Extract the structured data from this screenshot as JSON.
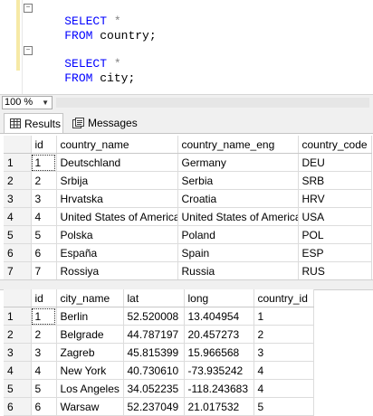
{
  "editor": {
    "lines": [
      {
        "kw": "SELECT",
        "rest": " *"
      },
      {
        "kw": "FROM",
        "rest": " country;"
      },
      {
        "kw": "",
        "rest": ""
      },
      {
        "kw": "SELECT",
        "rest": " *"
      },
      {
        "kw": "FROM",
        "rest": " city;"
      }
    ],
    "colors": {
      "keyword": "#0000ff",
      "operator": "#808080",
      "gutter_marker": "#f6e9a6"
    }
  },
  "zoom": {
    "value": "100 %"
  },
  "tabs": [
    {
      "label": "Results",
      "icon": "grid-icon",
      "active": true
    },
    {
      "label": "Messages",
      "icon": "messages-icon",
      "active": false
    }
  ],
  "grids": [
    {
      "columns": [
        "id",
        "country_name",
        "country_name_eng",
        "country_code"
      ],
      "rows": [
        {
          "rn": "1",
          "cells": [
            "1",
            "Deutschland",
            "Germany",
            "DEU"
          ]
        },
        {
          "rn": "2",
          "cells": [
            "2",
            "Srbija",
            "Serbia",
            "SRB"
          ]
        },
        {
          "rn": "3",
          "cells": [
            "3",
            "Hrvatska",
            "Croatia",
            "HRV"
          ]
        },
        {
          "rn": "4",
          "cells": [
            "4",
            "United States of America",
            "United States of America",
            "USA"
          ]
        },
        {
          "rn": "5",
          "cells": [
            "5",
            "Polska",
            "Poland",
            "POL"
          ]
        },
        {
          "rn": "6",
          "cells": [
            "6",
            "España",
            "Spain",
            "ESP"
          ]
        },
        {
          "rn": "7",
          "cells": [
            "7",
            "Rossiya",
            "Russia",
            "RUS"
          ]
        }
      ]
    },
    {
      "columns": [
        "id",
        "city_name",
        "lat",
        "long",
        "country_id"
      ],
      "rows": [
        {
          "rn": "1",
          "cells": [
            "1",
            "Berlin",
            "52.520008",
            "13.404954",
            "1"
          ]
        },
        {
          "rn": "2",
          "cells": [
            "2",
            "Belgrade",
            "44.787197",
            "20.457273",
            "2"
          ]
        },
        {
          "rn": "3",
          "cells": [
            "3",
            "Zagreb",
            "45.815399",
            "15.966568",
            "3"
          ]
        },
        {
          "rn": "4",
          "cells": [
            "4",
            "New York",
            "40.730610",
            "-73.935242",
            "4"
          ]
        },
        {
          "rn": "5",
          "cells": [
            "5",
            "Los Angeles",
            "34.052235",
            "-118.243683",
            "4"
          ]
        },
        {
          "rn": "6",
          "cells": [
            "6",
            "Warsaw",
            "52.237049",
            "21.017532",
            "5"
          ]
        }
      ]
    }
  ]
}
